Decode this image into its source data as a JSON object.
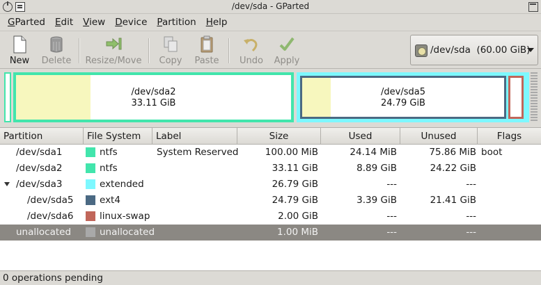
{
  "window": {
    "title": "/dev/sda - GParted"
  },
  "menu": [
    {
      "pre": "",
      "key": "G",
      "rest": "Parted"
    },
    {
      "pre": "",
      "key": "E",
      "rest": "dit"
    },
    {
      "pre": "",
      "key": "V",
      "rest": "iew"
    },
    {
      "pre": "",
      "key": "D",
      "rest": "evice"
    },
    {
      "pre": "",
      "key": "P",
      "rest": "artition"
    },
    {
      "pre": "",
      "key": "H",
      "rest": "elp"
    }
  ],
  "toolbar": {
    "new": "New",
    "delete": "Delete",
    "resize": "Resize/Move",
    "copy": "Copy",
    "paste": "Paste",
    "undo": "Undo",
    "apply": "Apply"
  },
  "device": {
    "path": "/dev/sda",
    "size": "(60.00 GiB)"
  },
  "diskmap": {
    "sda2": {
      "name": "/dev/sda2",
      "size": "33.11 GiB",
      "used_fraction": 0.27
    },
    "sda5": {
      "name": "/dev/sda5",
      "size": "24.79 GiB",
      "used_fraction": 0.14
    }
  },
  "columns": {
    "partition": "Partition",
    "filesystem": "File System",
    "label": "Label",
    "size": "Size",
    "used": "Used",
    "unused": "Unused",
    "flags": "Flags"
  },
  "rows": [
    {
      "partition": "/dev/sda1",
      "filesystem": "ntfs",
      "label": "System Reserved",
      "size": "100.00 MiB",
      "used": "24.14 MiB",
      "unused": "75.86 MiB",
      "flags": "boot",
      "color": "#42e5ac"
    },
    {
      "partition": "/dev/sda2",
      "filesystem": "ntfs",
      "label": "",
      "size": "33.11 GiB",
      "used": "8.89 GiB",
      "unused": "24.22 GiB",
      "flags": "",
      "color": "#42e5ac"
    },
    {
      "partition": "/dev/sda3",
      "filesystem": "extended",
      "label": "",
      "size": "26.79 GiB",
      "used": "---",
      "unused": "---",
      "flags": "",
      "color": "#7df8ff"
    },
    {
      "partition": "/dev/sda5",
      "filesystem": "ext4",
      "label": "",
      "size": "24.79 GiB",
      "used": "3.39 GiB",
      "unused": "21.41 GiB",
      "flags": "",
      "color": "#4b6983"
    },
    {
      "partition": "/dev/sda6",
      "filesystem": "linux-swap",
      "label": "",
      "size": "2.00 GiB",
      "used": "---",
      "unused": "---",
      "flags": "",
      "color": "#c1665a"
    },
    {
      "partition": "unallocated",
      "filesystem": "unallocated",
      "label": "",
      "size": "1.00 MiB",
      "used": "---",
      "unused": "---",
      "flags": "",
      "color": "#a9a9a9"
    }
  ],
  "status": {
    "text": "0 operations pending"
  },
  "colors": {
    "ntfs": "#42e5ac",
    "extended": "#7df8ff",
    "ext4": "#4b6983",
    "linux_swap": "#c1665a",
    "unallocated": "#a9a9a9",
    "used_fill": "#f7f7be",
    "selection": "#8b8883"
  }
}
